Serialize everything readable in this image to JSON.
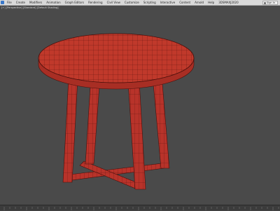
{
  "menu": {
    "items": [
      "File",
      "Create",
      "Modifiers",
      "Animation",
      "Graph Editors",
      "Rendering",
      "Civil View",
      "Customize",
      "Scripting",
      "Interactive",
      "Content",
      "Arnold",
      "Help",
      "3DSMAXJ2020"
    ],
    "sign_in": "Sign In"
  },
  "viewport": {
    "label": "[+] [Perspective] [Standard] [Default Shading]"
  },
  "scene": {
    "object": "round table",
    "color": "#c0392b",
    "wire_color": "#5e1510"
  },
  "colors": {
    "menubar": "#d9d9d9",
    "viewport_bg": "#4a4a4a",
    "timeline_bg": "#3b3b3b"
  }
}
